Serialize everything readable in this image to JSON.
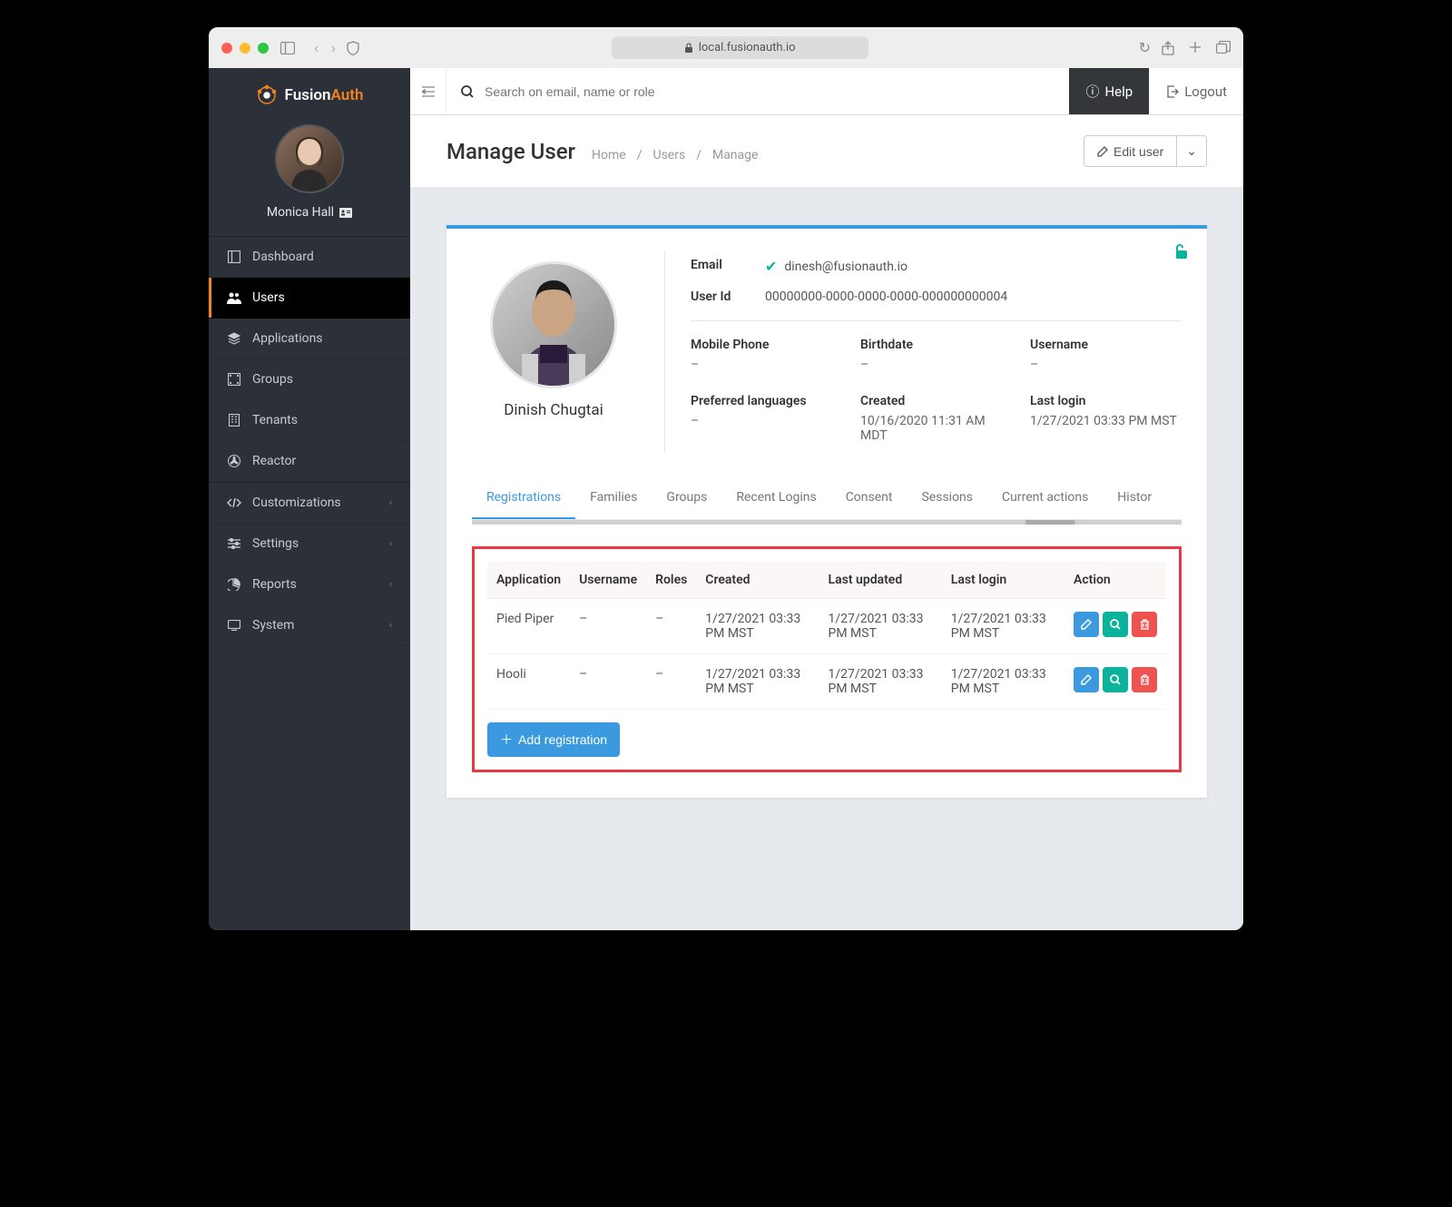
{
  "browser": {
    "url": "local.fusionauth.io"
  },
  "brand": {
    "name_first": "Fusion",
    "name_second": "Auth"
  },
  "current_user": {
    "name": "Monica Hall"
  },
  "sidebar": {
    "items": [
      {
        "label": "Dashboard"
      },
      {
        "label": "Users"
      },
      {
        "label": "Applications"
      },
      {
        "label": "Groups"
      },
      {
        "label": "Tenants"
      },
      {
        "label": "Reactor"
      },
      {
        "label": "Customizations"
      },
      {
        "label": "Settings"
      },
      {
        "label": "Reports"
      },
      {
        "label": "System"
      }
    ]
  },
  "topbar": {
    "search_placeholder": "Search on email, name or role",
    "help": "Help",
    "logout": "Logout"
  },
  "page": {
    "title": "Manage User",
    "crumbs": {
      "home": "Home",
      "users": "Users",
      "manage": "Manage"
    },
    "edit_button": "Edit user"
  },
  "user": {
    "name": "Dinish Chugtai",
    "email_label": "Email",
    "email": "dinesh@fusionauth.io",
    "userid_label": "User Id",
    "userid": "00000000-0000-0000-0000-000000000004",
    "fields": {
      "mobile_phone": {
        "label": "Mobile Phone",
        "value": "–"
      },
      "birthdate": {
        "label": "Birthdate",
        "value": "–"
      },
      "username": {
        "label": "Username",
        "value": "–"
      },
      "preferred_languages": {
        "label": "Preferred languages",
        "value": "–"
      },
      "created": {
        "label": "Created",
        "value": "10/16/2020 11:31 AM MDT"
      },
      "last_login": {
        "label": "Last login",
        "value": "1/27/2021 03:33 PM MST"
      }
    }
  },
  "tabs": [
    "Registrations",
    "Families",
    "Groups",
    "Recent Logins",
    "Consent",
    "Sessions",
    "Current actions",
    "Histor"
  ],
  "registrations": {
    "headers": {
      "application": "Application",
      "username": "Username",
      "roles": "Roles",
      "created": "Created",
      "last_updated": "Last updated",
      "last_login": "Last login",
      "action": "Action"
    },
    "rows": [
      {
        "application": "Pied Piper",
        "username": "–",
        "roles": "–",
        "created": "1/27/2021 03:33 PM MST",
        "last_updated": "1/27/2021 03:33 PM MST",
        "last_login": "1/27/2021 03:33 PM MST"
      },
      {
        "application": "Hooli",
        "username": "–",
        "roles": "–",
        "created": "1/27/2021 03:33 PM MST",
        "last_updated": "1/27/2021 03:33 PM MST",
        "last_login": "1/27/2021 03:33 PM MST"
      }
    ],
    "add_button": "Add registration"
  }
}
